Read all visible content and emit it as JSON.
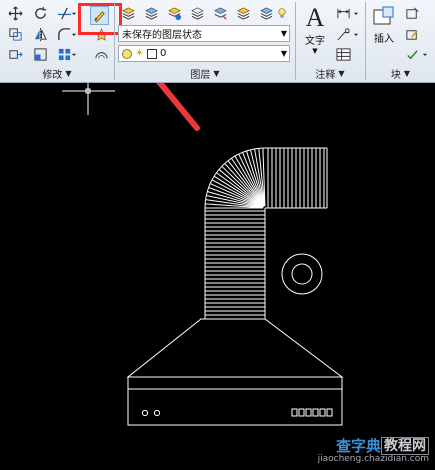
{
  "ribbon": {
    "panels": {
      "modify_label": "修改",
      "layers_label": "图层",
      "annotation_label": "注释",
      "block_label": "块"
    },
    "layer_state_combo": "未保存的图层状态",
    "layer_combo": "0",
    "text_button_label": "文字",
    "insert_button_label": "插入"
  },
  "watermark": {
    "site_name_1": "查字典",
    "site_name_2": "教程网",
    "url": "jiaocheng.chazidian.com"
  },
  "colors": {
    "highlight": "#ff2a2a",
    "arrow": "#e8393c",
    "canvas_bg": "#000000",
    "drawing_lines": "#ffffff"
  }
}
